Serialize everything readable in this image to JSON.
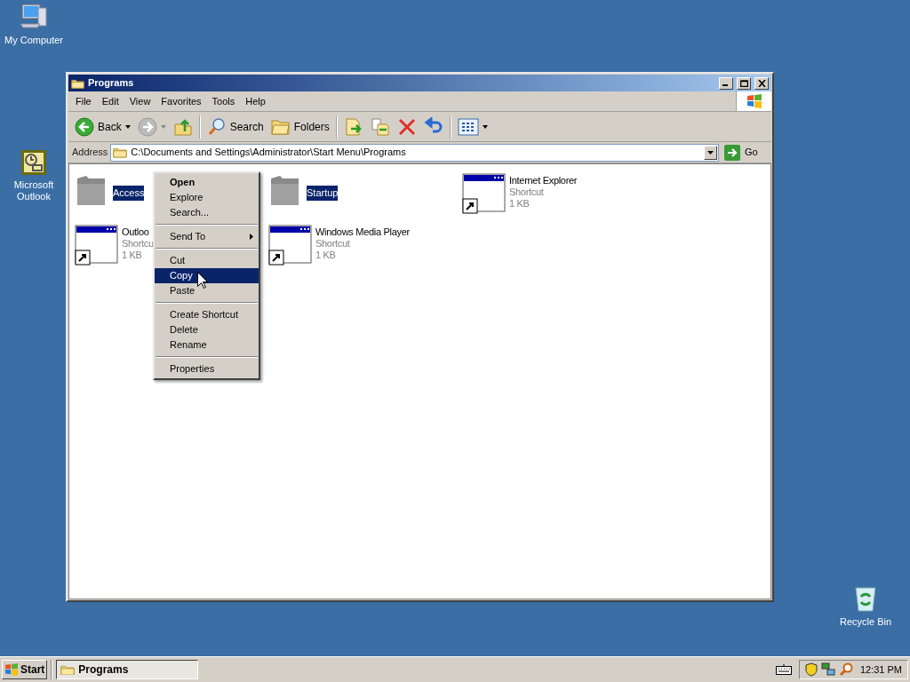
{
  "desktop_icons": [
    {
      "kind": "computer",
      "label": "My Computer"
    },
    {
      "kind": "outlook",
      "label": "Microsoft Outlook"
    },
    {
      "kind": "recycle",
      "label": "Recycle Bin"
    }
  ],
  "window": {
    "title": "Programs"
  },
  "menu_bar": [
    "File",
    "Edit",
    "View",
    "Favorites",
    "Tools",
    "Help"
  ],
  "toolbar": [
    {
      "kind": "back",
      "label": "Back"
    },
    {
      "kind": "forward"
    },
    {
      "kind": "up"
    },
    {
      "kind": "search",
      "label": "Search"
    },
    {
      "kind": "folders",
      "label": "Folders"
    },
    {
      "kind": "move"
    },
    {
      "kind": "copy"
    },
    {
      "kind": "delete"
    },
    {
      "kind": "undo"
    },
    {
      "kind": "views"
    }
  ],
  "address_bar": {
    "label": "Address",
    "value": "C:\\Documents and Settings\\Administrator\\Start Menu\\Programs",
    "go": "Go"
  },
  "items": [
    {
      "kind": "folder",
      "name": "Access",
      "selected": true
    },
    {
      "kind": "folder",
      "name": "Startup",
      "selected": true
    },
    {
      "kind": "shortcut",
      "name": "Internet Explorer",
      "type": "Shortcut",
      "size": "1 KB",
      "selected": false
    },
    {
      "kind": "shortcut",
      "name": "Outloo",
      "type": "Shortcu",
      "size": "1 KB",
      "selected": false
    },
    {
      "kind": "shortcut",
      "name": "Windows Media Player",
      "type": "Shortcut",
      "size": "1 KB",
      "selected": false
    }
  ],
  "context_menu": [
    {
      "kind": "item",
      "label": "Open",
      "default": true,
      "submenu": false,
      "selected": false
    },
    {
      "kind": "item",
      "label": "Explore",
      "default": false,
      "submenu": false,
      "selected": false
    },
    {
      "kind": "item",
      "label": "Search...",
      "default": false,
      "submenu": false,
      "selected": false
    },
    {
      "kind": "separator"
    },
    {
      "kind": "item",
      "label": "Send To",
      "default": false,
      "submenu": true,
      "selected": false
    },
    {
      "kind": "separator"
    },
    {
      "kind": "item",
      "label": "Cut",
      "default": false,
      "submenu": false,
      "selected": false
    },
    {
      "kind": "item",
      "label": "Copy",
      "default": false,
      "submenu": false,
      "selected": true
    },
    {
      "kind": "item",
      "label": "Paste",
      "default": false,
      "submenu": false,
      "selected": false
    },
    {
      "kind": "separator"
    },
    {
      "kind": "item",
      "label": "Create Shortcut",
      "default": false,
      "submenu": false,
      "selected": false
    },
    {
      "kind": "item",
      "label": "Delete",
      "default": false,
      "submenu": false,
      "selected": false
    },
    {
      "kind": "item",
      "label": "Rename",
      "default": false,
      "submenu": false,
      "selected": false
    },
    {
      "kind": "separator"
    },
    {
      "kind": "item",
      "label": "Properties",
      "default": false,
      "submenu": false,
      "selected": false
    }
  ],
  "taskbar": {
    "start": "Start",
    "tasks": [
      {
        "label": "Programs",
        "selected": true
      }
    ],
    "clock": "12:31 PM"
  }
}
